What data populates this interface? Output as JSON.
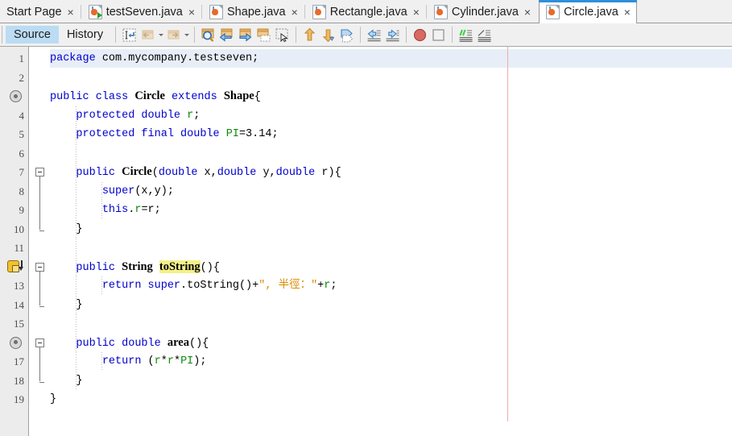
{
  "tabs": [
    {
      "label": "Start Page",
      "icon": null,
      "close": "×",
      "active": false
    },
    {
      "label": "testSeven.java",
      "icon": "java-run-file-icon",
      "close": "×",
      "active": false
    },
    {
      "label": "Shape.java",
      "icon": "java-file-icon",
      "close": "×",
      "active": false
    },
    {
      "label": "Rectangle.java",
      "icon": "java-file-icon",
      "close": "×",
      "active": false
    },
    {
      "label": "Cylinder.java",
      "icon": "java-file-icon",
      "close": "×",
      "active": false
    },
    {
      "label": "Circle.java",
      "icon": "java-file-icon",
      "close": "×",
      "active": true
    }
  ],
  "toolbar": {
    "view_tabs": [
      {
        "label": "Source",
        "selected": true
      },
      {
        "label": "History",
        "selected": false
      }
    ],
    "buttons": [
      {
        "name": "last-edit-position-icon",
        "enabled": true
      },
      {
        "name": "back-icon",
        "enabled": false
      },
      {
        "name": "back-dropdown-caret-icon",
        "enabled": false
      },
      {
        "name": "forward-icon",
        "enabled": false
      },
      {
        "name": "forward-dropdown-caret-icon",
        "enabled": false
      },
      {
        "name": "find-selection-icon",
        "enabled": true
      },
      {
        "name": "find-previous-icon",
        "enabled": true
      },
      {
        "name": "find-next-icon",
        "enabled": true
      },
      {
        "name": "toggle-highlight-icon",
        "enabled": true
      },
      {
        "name": "toggle-rectangular-selection-icon",
        "enabled": true
      },
      {
        "name": "previous-bookmark-icon",
        "enabled": true
      },
      {
        "name": "next-bookmark-icon",
        "enabled": true
      },
      {
        "name": "toggle-bookmark-icon",
        "enabled": true
      },
      {
        "name": "shift-left-icon",
        "enabled": true
      },
      {
        "name": "shift-right-icon",
        "enabled": true
      },
      {
        "name": "toggle-breakpoint-icon",
        "enabled": true
      },
      {
        "name": "stop-icon",
        "enabled": true
      },
      {
        "name": "comment-icon",
        "enabled": true
      },
      {
        "name": "uncomment-icon",
        "enabled": true
      }
    ]
  },
  "editor": {
    "active_line": 1,
    "right_margin_column_guide": true,
    "lines": [
      {
        "num": "1",
        "annotation": null,
        "fold": null,
        "indent": 0,
        "tokens": [
          {
            "t": "package",
            "c": "kw"
          },
          {
            "t": " com.mycompany.testseven;",
            "c": "plain"
          }
        ]
      },
      {
        "num": "2",
        "annotation": null,
        "fold": null,
        "indent": 0,
        "tokens": []
      },
      {
        "num": "3",
        "annotation": "overridden-icon",
        "fold": null,
        "indent": 0,
        "tokens": [
          {
            "t": "public class ",
            "c": "kw"
          },
          {
            "t": "Circle",
            "c": "typ"
          },
          {
            "t": " ",
            "c": "plain"
          },
          {
            "t": "extends",
            "c": "kw"
          },
          {
            "t": " ",
            "c": "plain"
          },
          {
            "t": "Shape",
            "c": "typ"
          },
          {
            "t": "{",
            "c": "plain"
          }
        ]
      },
      {
        "num": "4",
        "annotation": null,
        "fold": null,
        "indent": 1,
        "tokens": [
          {
            "t": "    ",
            "c": "plain"
          },
          {
            "t": "protected double",
            "c": "kw"
          },
          {
            "t": " ",
            "c": "plain"
          },
          {
            "t": "r",
            "c": "fld"
          },
          {
            "t": ";",
            "c": "plain"
          }
        ]
      },
      {
        "num": "5",
        "annotation": null,
        "fold": null,
        "indent": 1,
        "tokens": [
          {
            "t": "    ",
            "c": "plain"
          },
          {
            "t": "protected final double",
            "c": "kw"
          },
          {
            "t": " ",
            "c": "plain"
          },
          {
            "t": "PI",
            "c": "fld"
          },
          {
            "t": "=3.14;",
            "c": "plain"
          }
        ]
      },
      {
        "num": "6",
        "annotation": null,
        "fold": null,
        "indent": 1,
        "tokens": []
      },
      {
        "num": "7",
        "annotation": null,
        "fold": "start",
        "indent": 1,
        "tokens": [
          {
            "t": "    ",
            "c": "plain"
          },
          {
            "t": "public",
            "c": "kw"
          },
          {
            "t": " ",
            "c": "plain"
          },
          {
            "t": "Circle",
            "c": "typ"
          },
          {
            "t": "(",
            "c": "plain"
          },
          {
            "t": "double",
            "c": "kw"
          },
          {
            "t": " x,",
            "c": "plain"
          },
          {
            "t": "double",
            "c": "kw"
          },
          {
            "t": " y,",
            "c": "plain"
          },
          {
            "t": "double",
            "c": "kw"
          },
          {
            "t": " r){",
            "c": "plain"
          }
        ]
      },
      {
        "num": "8",
        "annotation": null,
        "fold": "mid",
        "indent": 2,
        "tokens": [
          {
            "t": "        ",
            "c": "plain"
          },
          {
            "t": "super",
            "c": "kw"
          },
          {
            "t": "(x,y);",
            "c": "plain"
          }
        ]
      },
      {
        "num": "9",
        "annotation": null,
        "fold": "mid",
        "indent": 2,
        "tokens": [
          {
            "t": "        ",
            "c": "plain"
          },
          {
            "t": "this",
            "c": "kw"
          },
          {
            "t": ".",
            "c": "plain"
          },
          {
            "t": "r",
            "c": "fld"
          },
          {
            "t": "=r;",
            "c": "plain"
          }
        ]
      },
      {
        "num": "10",
        "annotation": null,
        "fold": "end",
        "indent": 1,
        "tokens": [
          {
            "t": "    }",
            "c": "plain"
          }
        ]
      },
      {
        "num": "11",
        "annotation": null,
        "fold": null,
        "indent": 1,
        "tokens": []
      },
      {
        "num": "12",
        "annotation": "warning-overrides-icon",
        "fold": "start",
        "indent": 1,
        "tokens": [
          {
            "t": "    ",
            "c": "plain"
          },
          {
            "t": "public",
            "c": "kw"
          },
          {
            "t": " ",
            "c": "plain"
          },
          {
            "t": "String",
            "c": "typ"
          },
          {
            "t": " ",
            "c": "plain"
          },
          {
            "t": "toString",
            "c": "mark"
          },
          {
            "t": "(){",
            "c": "plain"
          }
        ]
      },
      {
        "num": "13",
        "annotation": null,
        "fold": "mid",
        "indent": 2,
        "tokens": [
          {
            "t": "        ",
            "c": "plain"
          },
          {
            "t": "return",
            "c": "kw"
          },
          {
            "t": " ",
            "c": "plain"
          },
          {
            "t": "super",
            "c": "kw"
          },
          {
            "t": ".toString()+",
            "c": "plain"
          },
          {
            "t": "\", 半徑：\"",
            "c": "str"
          },
          {
            "t": "+",
            "c": "plain"
          },
          {
            "t": "r",
            "c": "fld"
          },
          {
            "t": ";",
            "c": "plain"
          }
        ]
      },
      {
        "num": "14",
        "annotation": null,
        "fold": "end",
        "indent": 1,
        "tokens": [
          {
            "t": "    }",
            "c": "plain"
          }
        ]
      },
      {
        "num": "15",
        "annotation": null,
        "fold": null,
        "indent": 1,
        "tokens": []
      },
      {
        "num": "16",
        "annotation": "overridden-icon",
        "fold": "start",
        "indent": 1,
        "tokens": [
          {
            "t": "    ",
            "c": "plain"
          },
          {
            "t": "public double",
            "c": "kw"
          },
          {
            "t": " ",
            "c": "plain"
          },
          {
            "t": "area",
            "c": "typ"
          },
          {
            "t": "(){",
            "c": "plain"
          }
        ]
      },
      {
        "num": "17",
        "annotation": null,
        "fold": "mid",
        "indent": 2,
        "tokens": [
          {
            "t": "        ",
            "c": "plain"
          },
          {
            "t": "return",
            "c": "kw"
          },
          {
            "t": " (",
            "c": "plain"
          },
          {
            "t": "r",
            "c": "fld"
          },
          {
            "t": "*",
            "c": "plain"
          },
          {
            "t": "r",
            "c": "fld"
          },
          {
            "t": "*",
            "c": "plain"
          },
          {
            "t": "PI",
            "c": "fld"
          },
          {
            "t": ");",
            "c": "plain"
          }
        ]
      },
      {
        "num": "18",
        "annotation": null,
        "fold": "end",
        "indent": 1,
        "tokens": [
          {
            "t": "    }",
            "c": "plain"
          }
        ]
      },
      {
        "num": "19",
        "annotation": null,
        "fold": null,
        "indent": 0,
        "tokens": [
          {
            "t": "}",
            "c": "plain"
          }
        ]
      }
    ]
  },
  "colors": {
    "accent": "#2f8fdc",
    "selected_tab_bg": "#bcdcf4",
    "active_line": "#e8eef7",
    "margin_guide": "#f4a9a9",
    "keyword": "#0000cc",
    "field": "#0a8a0a",
    "string": "#d98c00",
    "highlight": "#f5f08a"
  }
}
